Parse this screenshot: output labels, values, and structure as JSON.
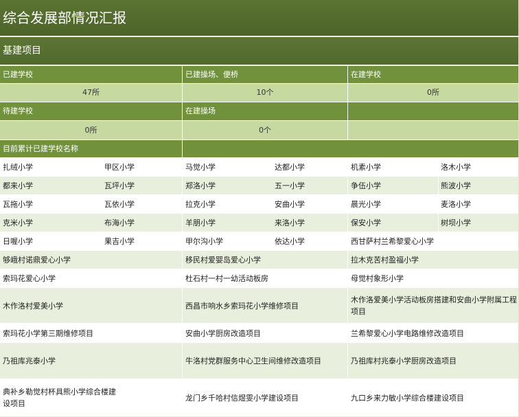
{
  "title": "综合发展部情况汇报",
  "section": "基建项目",
  "stats": {
    "built_label": "已建学校",
    "built_value": "47所",
    "playground_label": "已建操场、便桥",
    "playground_value": "10个",
    "building_label": "在建学校",
    "building_value": "0所",
    "pending_label": "待建学校",
    "pending_value": "0所",
    "playground_building_label": "在建操场",
    "playground_building_value": "0个"
  },
  "list_header": "目前累计已建学校名称",
  "rows": [
    [
      "扎绒小学",
      "甲区小学",
      "马觉小学",
      "达都小学",
      "机素小学",
      "洛木小学"
    ],
    [
      "都来小学",
      "瓦坪小学",
      "郑洛小学",
      "五一小学",
      "争伍小学",
      "熊波小学"
    ],
    [
      "瓦拖小学",
      "瓦依小学",
      "拉克小学",
      "安曲小学",
      "晨光小学",
      "麦洛小学"
    ],
    [
      "克米小学",
      "布海小学",
      "羊朋小学",
      "来洛小学",
      "保安小学",
      "树坝小学"
    ],
    [
      "日喔小学",
      "果吉小学",
      "甲尔沟小学",
      "依达小学",
      "西甘萨村兰希黎爱心小学"
    ]
  ],
  "rows3": [
    [
      "够峨村诺鼎爱心小学",
      "移民村爱婴岛爱心小学",
      "拉木克苦村盈福小学"
    ],
    [
      "索玛花爱心小学",
      "杜石村一村一幼活动板房",
      "母觉村象形小学"
    ],
    [
      "木作洛村爱美小学",
      "西昌市响水乡索玛花小学维修项目",
      "木作洛爱美小学活动板房搭建和安曲小学附属工程项目"
    ],
    [
      "索玛花小学第三期维修项目",
      "安曲小学厨房改造项目",
      "兰希黎爱心小学电路维修改造项目"
    ],
    [
      "乃祖库兆泰小学",
      "牛洛村党群服务中心卫生间维修改造项目",
      "乃祖库村兆泰小学厨房改造项目"
    ],
    [
      "典补乡勒觉村杯具熊小学综合楼建设项目",
      "龙门乡千哈村信煜雯小学建设项目",
      "九口乡来力敏小学综合楼建设项目"
    ]
  ]
}
